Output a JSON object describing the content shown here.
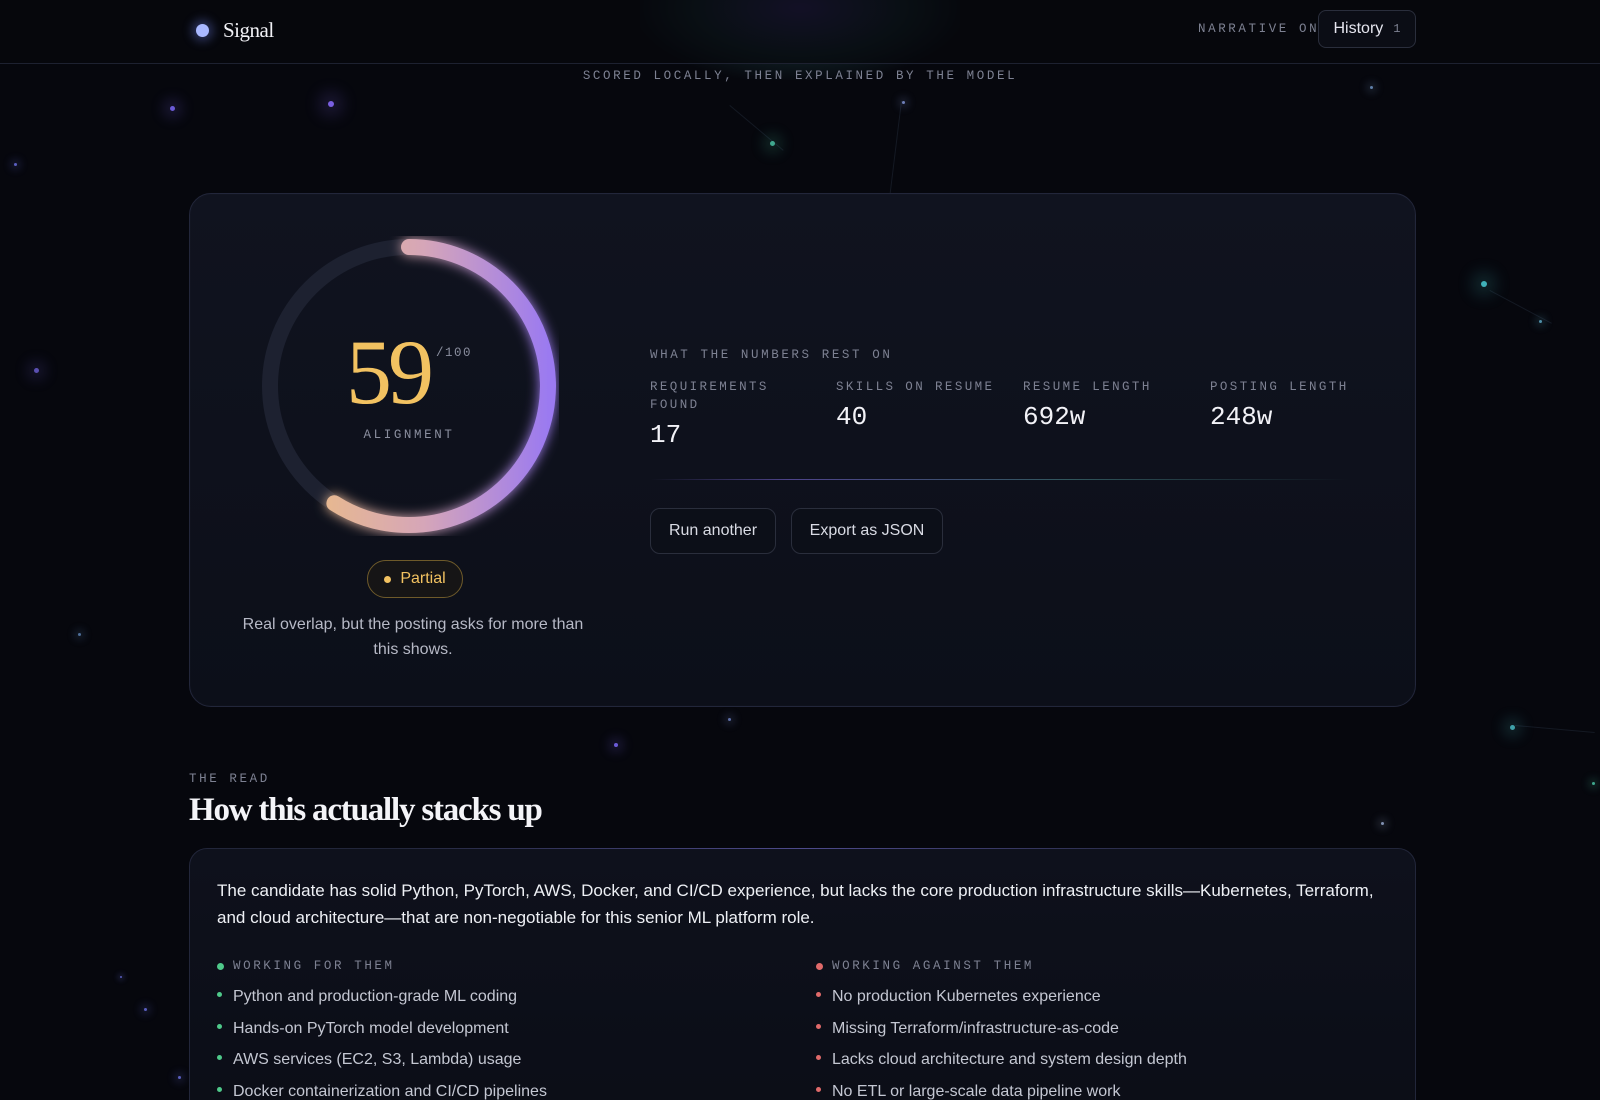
{
  "header": {
    "brand": "Signal",
    "narrative_status": "NARRATIVE ON",
    "history_label": "History",
    "history_count": "1"
  },
  "subtitle": "SCORED LOCALLY, THEN EXPLAINED BY THE MODEL",
  "score_card": {
    "score": "59",
    "score_max": "/100",
    "score_label": "ALIGNMENT",
    "score_fraction": 0.59,
    "badge": "Partial",
    "verdict": "Real overlap, but the posting asks for more than this shows.",
    "metrics_eyebrow": "WHAT THE NUMBERS REST ON",
    "metrics": [
      {
        "label": "REQUIREMENTS FOUND",
        "value": "17"
      },
      {
        "label": "SKILLS ON RESUME",
        "value": "40"
      },
      {
        "label": "RESUME LENGTH",
        "value": "692w"
      },
      {
        "label": "POSTING LENGTH",
        "value": "248w"
      }
    ],
    "actions": {
      "run_another": "Run another",
      "export_json": "Export as JSON"
    }
  },
  "read": {
    "eyebrow": "THE READ",
    "title": "How this actually stacks up",
    "summary": "The candidate has solid Python, PyTorch, AWS, Docker, and CI/CD experience, but lacks the core production infrastructure skills—Kubernetes, Terraform, and cloud architecture—that are non-negotiable for this senior ML platform role.",
    "for": {
      "title": "WORKING FOR THEM",
      "items": [
        "Python and production-grade ML coding",
        "Hands-on PyTorch model development",
        "AWS services (EC2, S3, Lambda) usage",
        "Docker containerization and CI/CD pipelines"
      ]
    },
    "against": {
      "title": "WORKING AGAINST THEM",
      "items": [
        "No production Kubernetes experience",
        "Missing Terraform/infrastructure-as-code",
        "Lacks cloud architecture and system design depth",
        "No ETL or large-scale data pipeline work"
      ]
    }
  },
  "colors": {
    "accent_gold": "#f2c261",
    "accent_violet": "#9b7af0",
    "positive": "#4fc98a",
    "negative": "#e06a6a"
  }
}
